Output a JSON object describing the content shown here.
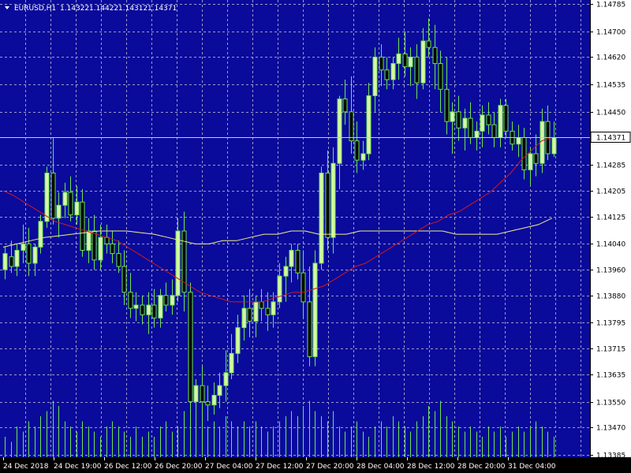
{
  "header": {
    "symbol_tf": "EURUSD,H1",
    "open": "1.14322",
    "high": "1.14422",
    "low": "1.14312",
    "close": "1.14371"
  },
  "colors": {
    "background": "#0A0A9B",
    "grid": "#9C9CC8",
    "candle_bull_fill": "#D8F5A8",
    "candle_bear_fill": "#000000",
    "candle_outline": "#6EE64B",
    "ma_fast": "#D11A1A",
    "ma_slow": "#F2F08A",
    "volume": "#6EE64B",
    "current_price_line": "#C9C9D8",
    "axis_panel": "#FFFFFF"
  },
  "chart_data": {
    "type": "candlestick",
    "y_ticks": [
      "1.14785",
      "1.14700",
      "1.14620",
      "1.14535",
      "1.14450",
      "1.14371",
      "1.14285",
      "1.14205",
      "1.14125",
      "1.14040",
      "1.13960",
      "1.13880",
      "1.13795",
      "1.13715",
      "1.13635",
      "1.13550",
      "1.13470",
      "1.13385"
    ],
    "x_ticks": [
      "24 Dec 2018",
      "24 Dec 19:00",
      "26 Dec 12:00",
      "26 Dec 20:00",
      "27 Dec 04:00",
      "27 Dec 12:00",
      "27 Dec 20:00",
      "28 Dec 04:00",
      "28 Dec 12:00",
      "28 Dec 20:00",
      "31 Dec 04:00"
    ],
    "ylim": [
      1.13385,
      1.14785
    ],
    "current_price": "1.14371",
    "candles": [
      [
        1.1396,
        1.1403,
        1.1393,
        1.1401
      ],
      [
        1.14,
        1.1405,
        1.1395,
        1.1397
      ],
      [
        1.1397,
        1.1404,
        1.1394,
        1.1402
      ],
      [
        1.1402,
        1.141,
        1.1398,
        1.1404
      ],
      [
        1.1404,
        1.1409,
        1.1394,
        1.1398
      ],
      [
        1.1398,
        1.1404,
        1.1394,
        1.1403
      ],
      [
        1.1403,
        1.1413,
        1.1401,
        1.1411
      ],
      [
        1.1411,
        1.1428,
        1.1409,
        1.1426
      ],
      [
        1.1426,
        1.1437,
        1.141,
        1.1412
      ],
      [
        1.1412,
        1.142,
        1.1406,
        1.1416
      ],
      [
        1.1416,
        1.1423,
        1.1412,
        1.142
      ],
      [
        1.142,
        1.1425,
        1.1411,
        1.1413
      ],
      [
        1.1413,
        1.1422,
        1.141,
        1.1417
      ],
      [
        1.1417,
        1.1421,
        1.14,
        1.1402
      ],
      [
        1.1402,
        1.1412,
        1.1398,
        1.1408
      ],
      [
        1.1408,
        1.1413,
        1.1396,
        1.1399
      ],
      [
        1.1399,
        1.141,
        1.1396,
        1.1406
      ],
      [
        1.1406,
        1.141,
        1.1401,
        1.1404
      ],
      [
        1.1404,
        1.1408,
        1.1398,
        1.1401
      ],
      [
        1.1401,
        1.1405,
        1.1395,
        1.1397
      ],
      [
        1.1397,
        1.1402,
        1.1385,
        1.1389
      ],
      [
        1.1389,
        1.1395,
        1.1381,
        1.1384
      ],
      [
        1.1384,
        1.1389,
        1.138,
        1.1385
      ],
      [
        1.1385,
        1.1388,
        1.1379,
        1.1382
      ],
      [
        1.1382,
        1.1389,
        1.1376,
        1.1385
      ],
      [
        1.1385,
        1.139,
        1.1378,
        1.1381
      ],
      [
        1.1381,
        1.139,
        1.1378,
        1.1388
      ],
      [
        1.1388,
        1.1392,
        1.1383,
        1.1385
      ],
      [
        1.1385,
        1.1393,
        1.1382,
        1.1388
      ],
      [
        1.1388,
        1.1412,
        1.1386,
        1.1408
      ],
      [
        1.1408,
        1.1414,
        1.1383,
        1.1389
      ],
      [
        1.1389,
        1.1392,
        1.135,
        1.1355
      ],
      [
        1.1355,
        1.1362,
        1.135,
        1.136
      ],
      [
        1.136,
        1.1366,
        1.1352,
        1.1355
      ],
      [
        1.1355,
        1.136,
        1.1349,
        1.1354
      ],
      [
        1.1354,
        1.1361,
        1.1351,
        1.1357
      ],
      [
        1.1357,
        1.1364,
        1.1353,
        1.136
      ],
      [
        1.136,
        1.1371,
        1.1355,
        1.1364
      ],
      [
        1.1364,
        1.1376,
        1.1362,
        1.137
      ],
      [
        1.137,
        1.1382,
        1.1367,
        1.1378
      ],
      [
        1.1378,
        1.1388,
        1.1374,
        1.1384
      ],
      [
        1.1384,
        1.139,
        1.1375,
        1.138
      ],
      [
        1.138,
        1.1388,
        1.1375,
        1.1386
      ],
      [
        1.1386,
        1.139,
        1.138,
        1.1384
      ],
      [
        1.1384,
        1.1389,
        1.1377,
        1.1382
      ],
      [
        1.1382,
        1.1389,
        1.1378,
        1.1386
      ],
      [
        1.1386,
        1.1398,
        1.1384,
        1.1394
      ],
      [
        1.1394,
        1.14,
        1.1386,
        1.1397
      ],
      [
        1.1397,
        1.1404,
        1.1392,
        1.1402
      ],
      [
        1.1402,
        1.1404,
        1.1393,
        1.1395
      ],
      [
        1.1395,
        1.1402,
        1.1381,
        1.1386
      ],
      [
        1.1386,
        1.1397,
        1.1366,
        1.1369
      ],
      [
        1.1369,
        1.1402,
        1.1366,
        1.1398
      ],
      [
        1.1398,
        1.1428,
        1.1396,
        1.1426
      ],
      [
        1.1426,
        1.1433,
        1.1402,
        1.1406
      ],
      [
        1.1406,
        1.1434,
        1.1401,
        1.1429
      ],
      [
        1.1429,
        1.145,
        1.1421,
        1.1449
      ],
      [
        1.1449,
        1.1455,
        1.1441,
        1.1445
      ],
      [
        1.1445,
        1.1456,
        1.1432,
        1.1436
      ],
      [
        1.1436,
        1.1442,
        1.1426,
        1.143
      ],
      [
        1.143,
        1.1436,
        1.1427,
        1.1432
      ],
      [
        1.1432,
        1.1454,
        1.143,
        1.145
      ],
      [
        1.145,
        1.1465,
        1.1445,
        1.1462
      ],
      [
        1.1462,
        1.1466,
        1.1453,
        1.1458
      ],
      [
        1.1458,
        1.1462,
        1.1452,
        1.1455
      ],
      [
        1.1455,
        1.1462,
        1.1452,
        1.146
      ],
      [
        1.146,
        1.1468,
        1.1455,
        1.1463
      ],
      [
        1.1463,
        1.147,
        1.1456,
        1.1459
      ],
      [
        1.1459,
        1.1465,
        1.1453,
        1.1462
      ],
      [
        1.1462,
        1.1466,
        1.1449,
        1.1454
      ],
      [
        1.1454,
        1.1471,
        1.1452,
        1.1467
      ],
      [
        1.1467,
        1.1474,
        1.1462,
        1.1465
      ],
      [
        1.1465,
        1.1472,
        1.1452,
        1.146
      ],
      [
        1.146,
        1.1464,
        1.1445,
        1.1452
      ],
      [
        1.1452,
        1.1462,
        1.1438,
        1.1442
      ],
      [
        1.1442,
        1.1448,
        1.1432,
        1.1445
      ],
      [
        1.1445,
        1.145,
        1.1436,
        1.144
      ],
      [
        1.144,
        1.1446,
        1.1433,
        1.1443
      ],
      [
        1.1443,
        1.1448,
        1.1435,
        1.1437
      ],
      [
        1.1437,
        1.1442,
        1.1433,
        1.1439
      ],
      [
        1.1439,
        1.1447,
        1.1434,
        1.1444
      ],
      [
        1.1444,
        1.1448,
        1.1438,
        1.1441
      ],
      [
        1.1441,
        1.1445,
        1.1434,
        1.1437
      ],
      [
        1.1437,
        1.1449,
        1.1434,
        1.1447
      ],
      [
        1.1447,
        1.1449,
        1.1437,
        1.1439
      ],
      [
        1.1439,
        1.1442,
        1.1433,
        1.1435
      ],
      [
        1.1435,
        1.1441,
        1.1431,
        1.1437
      ],
      [
        1.1437,
        1.144,
        1.1424,
        1.1427
      ],
      [
        1.1427,
        1.1434,
        1.1422,
        1.1432
      ],
      [
        1.1432,
        1.1438,
        1.1425,
        1.1429
      ],
      [
        1.1429,
        1.1446,
        1.1426,
        1.1442
      ],
      [
        1.1442,
        1.1447,
        1.143,
        1.1432
      ],
      [
        1.1432,
        1.1442,
        1.1431,
        1.1437
      ]
    ],
    "ma_fast": [
      1.14205,
      1.1419,
      1.1417,
      1.1415,
      1.1413,
      1.1411,
      1.141,
      1.1409,
      1.1408,
      1.1407,
      1.1406,
      1.1405,
      1.1403,
      1.1401,
      1.1399,
      1.1397,
      1.1395,
      1.1393,
      1.1391,
      1.1389,
      1.1388,
      1.1387,
      1.1386,
      1.1386,
      1.1386,
      1.1386,
      1.1387,
      1.1388,
      1.1389,
      1.1389,
      1.139,
      1.1391,
      1.1393,
      1.1395,
      1.1397,
      1.1398,
      1.14,
      1.1402,
      1.1404,
      1.1406,
      1.1408,
      1.141,
      1.1411,
      1.1413,
      1.1414,
      1.1416,
      1.1418,
      1.142,
      1.1423,
      1.1426,
      1.143,
      1.1433,
      1.1436,
      1.14371
    ],
    "ma_slow": [
      1.1403,
      1.1404,
      1.1405,
      1.1406,
      1.14065,
      1.1407,
      1.14075,
      1.1408,
      1.1408,
      1.1408,
      1.14075,
      1.1407,
      1.1406,
      1.1405,
      1.1404,
      1.1404,
      1.1405,
      1.1405,
      1.1406,
      1.1407,
      1.1407,
      1.1408,
      1.1408,
      1.1407,
      1.1407,
      1.1407,
      1.1408,
      1.1408,
      1.1408,
      1.1408,
      1.1408,
      1.1408,
      1.1408,
      1.1407,
      1.1407,
      1.1407,
      1.1407,
      1.1408,
      1.1409,
      1.141,
      1.1412
    ],
    "volume": [
      0.2,
      0.15,
      0.3,
      0.25,
      0.35,
      0.3,
      0.4,
      0.45,
      0.55,
      0.5,
      0.35,
      0.3,
      0.25,
      0.35,
      0.3,
      0.25,
      0.2,
      0.3,
      0.35,
      0.3,
      0.25,
      0.2,
      0.3,
      0.2,
      0.25,
      0.2,
      0.3,
      0.35,
      0.25,
      0.3,
      0.45,
      0.4,
      0.45,
      0.5,
      0.3,
      0.35,
      0.3,
      0.4,
      0.35,
      0.3,
      0.35,
      0.3,
      0.35,
      0.3,
      0.25,
      0.3,
      0.35,
      0.4,
      0.45,
      0.4,
      0.5,
      0.55,
      0.45,
      0.4,
      0.35,
      0.45,
      0.3,
      0.25,
      0.3,
      0.35,
      0.25,
      0.2,
      0.3,
      0.35,
      0.3,
      0.4,
      0.35,
      0.3,
      0.25,
      0.35,
      0.4,
      0.5,
      0.45,
      0.55,
      0.4,
      0.35,
      0.3,
      0.25,
      0.3,
      0.25,
      0.2,
      0.3,
      0.25,
      0.3,
      0.2,
      0.25,
      0.3,
      0.25,
      0.3,
      0.35,
      0.3,
      0.25,
      0.2
    ]
  }
}
